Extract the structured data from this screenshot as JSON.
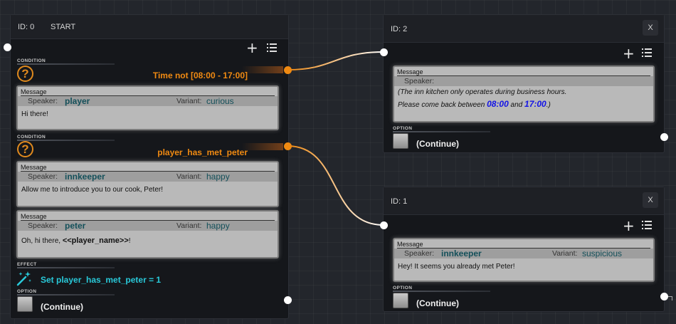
{
  "colors": {
    "condition": "#f08a12",
    "effect": "#29c9d9",
    "variable": "#1414e6",
    "speaker": "#14505a"
  },
  "icons": {
    "add": "plus-icon",
    "options": "list-icon",
    "condition": "question-icon",
    "effect": "magic-wand-icon"
  },
  "node0": {
    "id": "ID: 0",
    "title": "START",
    "condition_label": "CONDITION",
    "condition1": "Time not [08:00 - 17:00]",
    "msg1": {
      "label": "Message",
      "speaker_key": "Speaker:",
      "speaker": "player",
      "variant_key": "Variant:",
      "variant": "curious",
      "text": "Hi there!"
    },
    "condition2": "player_has_met_peter",
    "msg2": {
      "label": "Message",
      "speaker_key": "Speaker:",
      "speaker": "innkeeper",
      "variant_key": "Variant:",
      "variant": "happy",
      "text": "Allow me to introduce you to our cook, Peter!"
    },
    "msg3": {
      "label": "Message",
      "speaker_key": "Speaker:",
      "speaker": "peter",
      "variant_key": "Variant:",
      "variant": "happy",
      "text_pre": "Oh, hi there, ",
      "text_bold": "<<player_name>>",
      "text_post": "!"
    },
    "effect_label": "EFFECT",
    "effect": "Set player_has_met_peter = 1",
    "option_label": "OPTION",
    "option": "(Continue)"
  },
  "node2": {
    "id": "ID: 2",
    "close": "X",
    "msg": {
      "label": "Message",
      "speaker_key": "Speaker:",
      "line1": "(The inn kitchen only operates during business hours.",
      "line2_pre": "Please come back between ",
      "time1": "08:00",
      "line2_mid": " and ",
      "time2": "17:00",
      "line2_post": ".)"
    },
    "option_label": "OPTION",
    "option": "(Continue)"
  },
  "node1": {
    "id": "ID: 1",
    "close": "X",
    "msg": {
      "label": "Message",
      "speaker_key": "Speaker:",
      "speaker": "innkeeper",
      "variant_key": "Variant:",
      "variant": "suspicious",
      "text": "Hey! It seems you already met Peter!"
    },
    "option_label": "OPTION",
    "option": "(Continue)"
  }
}
